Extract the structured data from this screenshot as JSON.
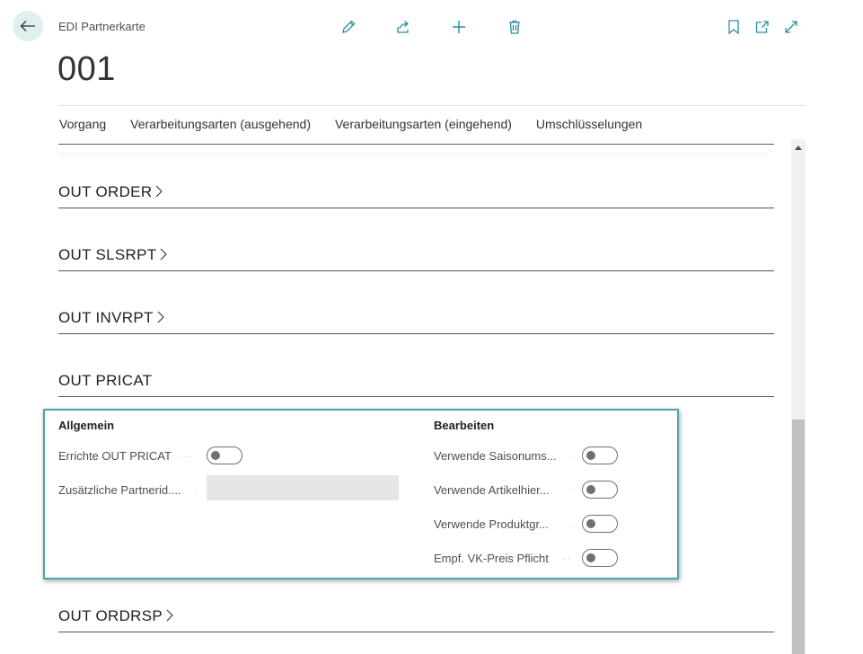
{
  "header": {
    "breadcrumb": "EDI Partnerkarte",
    "title": "001",
    "back_icon": "arrow-left-icon",
    "actions": [
      "edit-pencil-icon",
      "share-icon",
      "add-plus-icon",
      "delete-trash-icon"
    ],
    "right_actions": [
      "bookmark-icon",
      "open-new-window-icon",
      "expand-icon"
    ],
    "accent_color": "#4aa5b0"
  },
  "nav": {
    "tabs": [
      "Vorgang",
      "Verarbeitungsarten (ausgehend)",
      "Verarbeitungsarten (eingehend)",
      "Umschlüsselungen"
    ]
  },
  "sections": {
    "out_order": "OUT ORDER",
    "out_slsrpt": "OUT SLSRPT",
    "out_invrpt": "OUT INVRPT",
    "out_pricat": "OUT PRICAT",
    "out_ordrsp": "OUT ORDRSP"
  },
  "pricat": {
    "general": {
      "title": "Allgemein",
      "fields": [
        {
          "label": "Errichte OUT PRICAT",
          "type": "toggle",
          "value": false
        },
        {
          "label": "Zusätzliche Partnerid....",
          "type": "text",
          "value": ""
        }
      ]
    },
    "edit": {
      "title": "Bearbeiten",
      "fields": [
        {
          "label": "Verwende Saisonums...",
          "type": "toggle",
          "value": false
        },
        {
          "label": "Verwende Artikelhier...",
          "type": "toggle",
          "value": false
        },
        {
          "label": "Verwende Produktgr...",
          "type": "toggle",
          "value": false
        },
        {
          "label": "Empf. VK-Preis Pflicht",
          "type": "toggle",
          "value": false
        }
      ]
    }
  }
}
